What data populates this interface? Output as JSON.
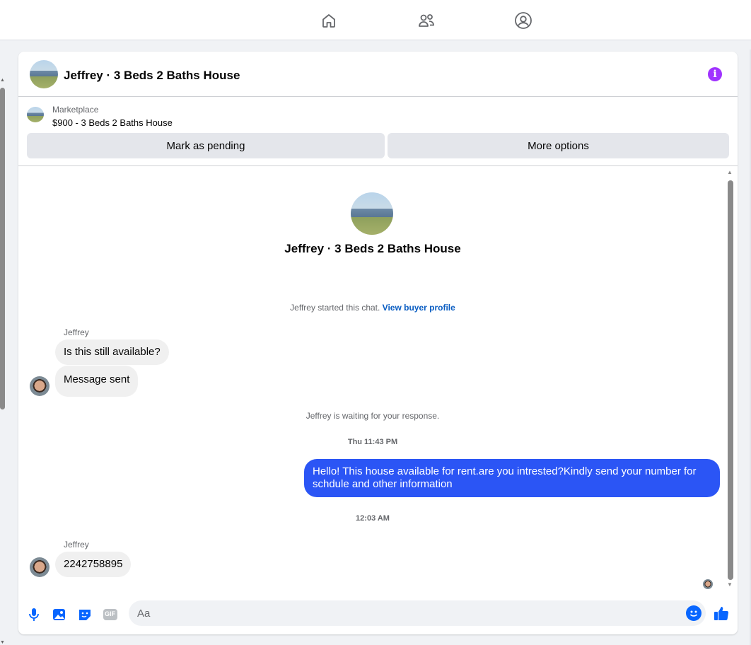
{
  "topnav": {
    "items": [
      {
        "icon": "home-icon"
      },
      {
        "icon": "friends-icon"
      },
      {
        "icon": "profile-icon"
      }
    ]
  },
  "chat": {
    "title": "Jeffrey · 3 Beds 2 Baths House",
    "info_icon": "i"
  },
  "listing": {
    "label": "Marketplace",
    "price_title": "$900 - 3 Beds 2 Baths House",
    "mark_pending": "Mark as pending",
    "more_options": "More options"
  },
  "conversation": {
    "intro_name": "Jeffrey · 3 Beds 2 Baths House",
    "started_text": "Jeffrey started this chat.",
    "view_profile": "View buyer profile",
    "group1_sender": "Jeffrey",
    "msg1": "Is this still available?",
    "msg2": "Message sent",
    "waiting_text": "Jeffrey is waiting for your response.",
    "ts1": "Thu 11:43 PM",
    "out_msg": "Hello! This house available for rent.are you intrested?Kindly send your number for schdule and other information",
    "ts2": "12:03 AM",
    "group2_sender": "Jeffrey",
    "msg3": "2242758895"
  },
  "composer": {
    "placeholder": "Aa",
    "gif_label": "GIF"
  },
  "colors": {
    "accent": "#0866ff",
    "outgoing_bubble": "#2b55f5",
    "info": "#a033ff"
  }
}
